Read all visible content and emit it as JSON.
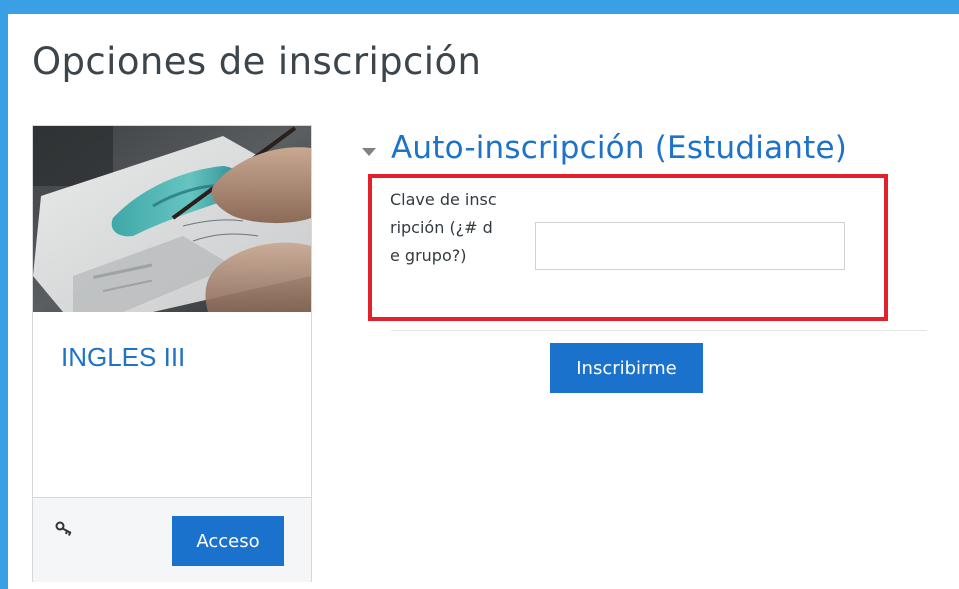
{
  "page": {
    "title": "Opciones de inscripción"
  },
  "course": {
    "name": "INGLES III",
    "image_alt": "painting-watercolor-image",
    "icons": {
      "enrol_method": "key-icon"
    },
    "access_label": "Acceso"
  },
  "self_enrolment": {
    "toggle_icon": "chevron-down-icon",
    "title": "Auto-inscripción (Estudiante)",
    "key_label": "Clave de inscripción (¿# de grupo?)",
    "key_value": "",
    "highlight_color": "#e22228",
    "submit_label": "Inscribirme"
  },
  "colors": {
    "accent": "#1b72cd",
    "link": "#1d72c9",
    "frame": "#3aa0e3"
  }
}
